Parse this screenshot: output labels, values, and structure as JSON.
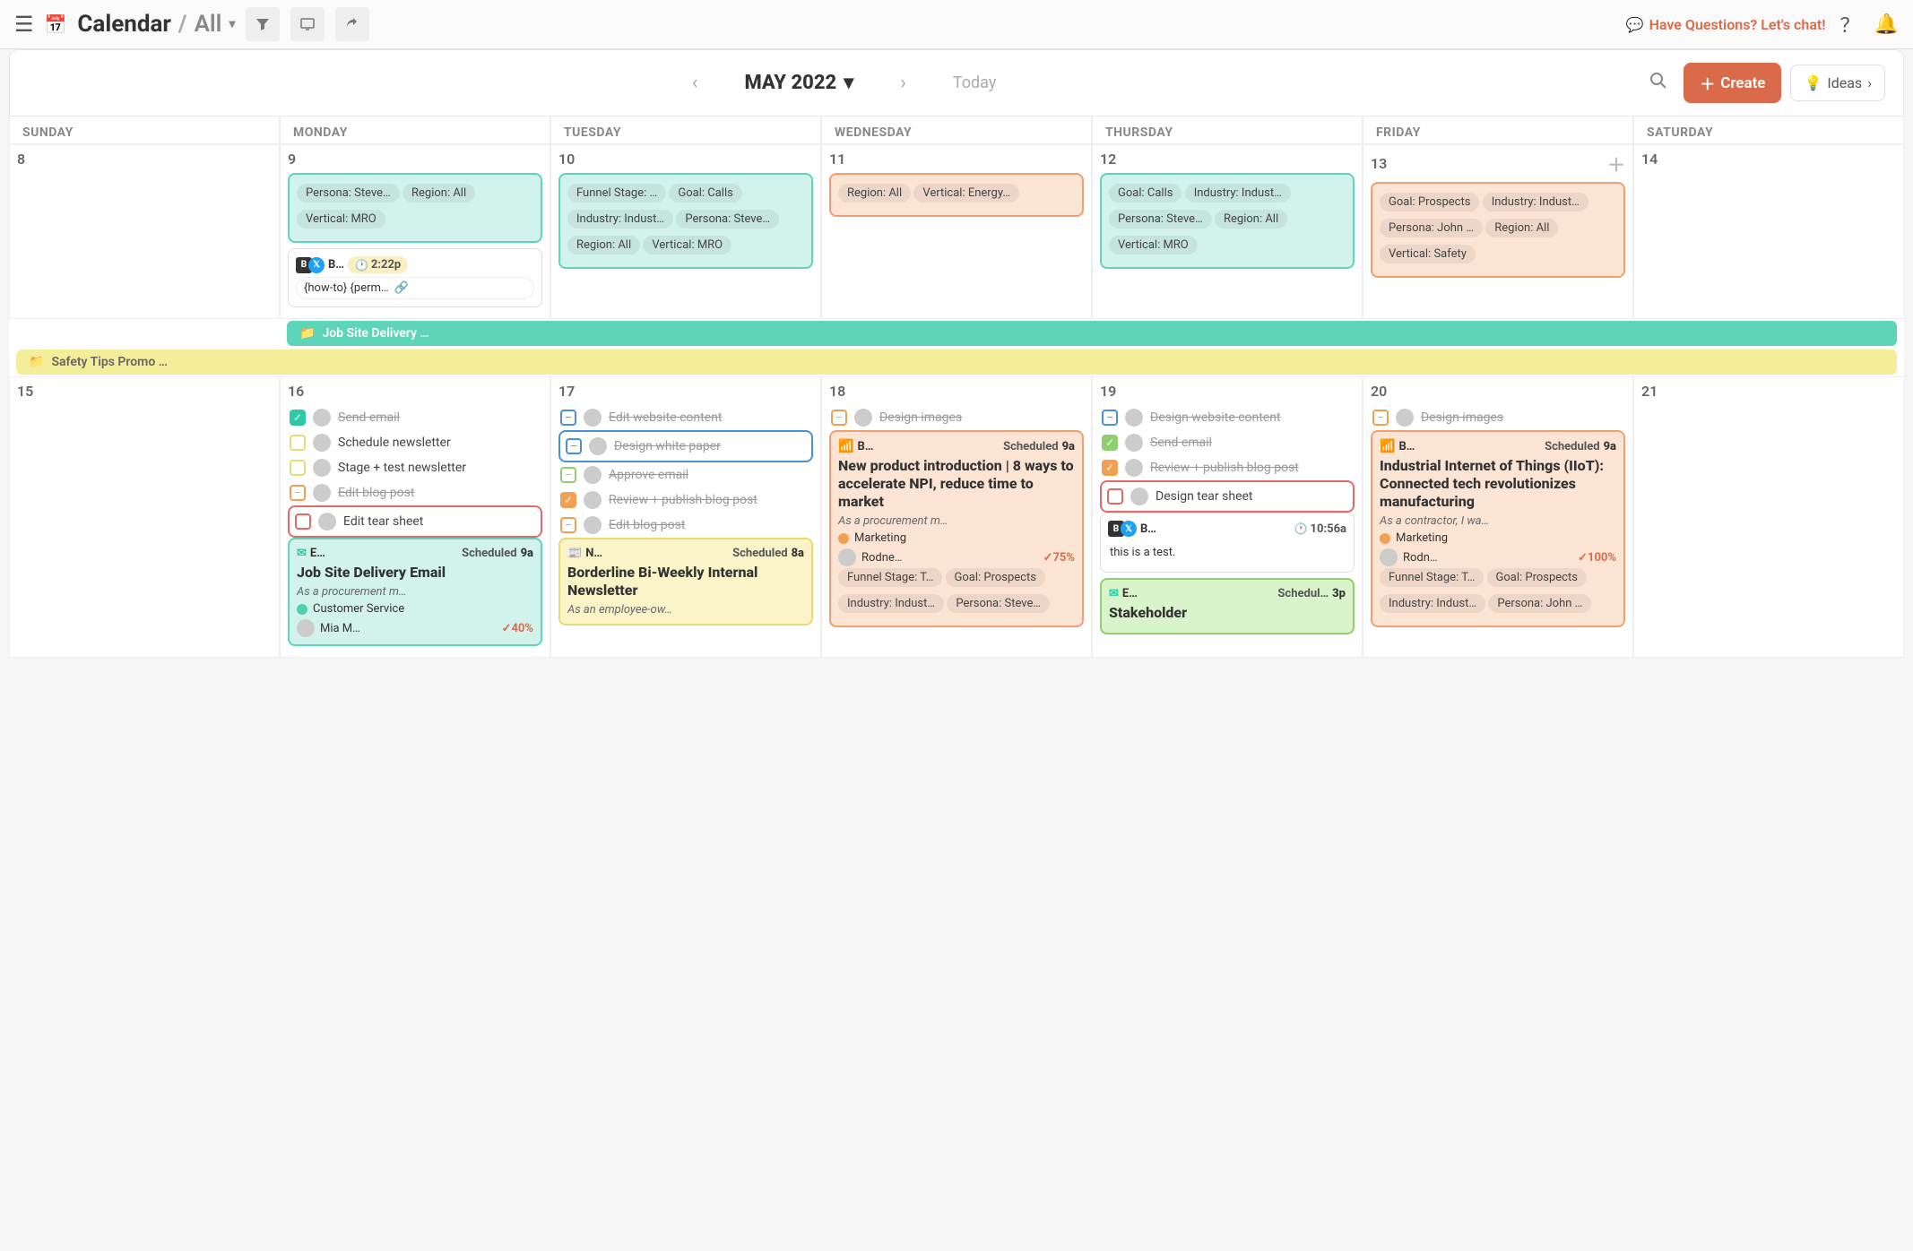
{
  "topbar": {
    "title": "Calendar",
    "filter": "All",
    "chat": "Have Questions? Let's chat!"
  },
  "subbar": {
    "month": "MAY 2022",
    "today": "Today",
    "create": "Create",
    "ideas": "Ideas"
  },
  "days": [
    "SUNDAY",
    "MONDAY",
    "TUESDAY",
    "WEDNESDAY",
    "THURSDAY",
    "FRIDAY",
    "SATURDAY"
  ],
  "week1": {
    "dates": [
      "8",
      "9",
      "10",
      "11",
      "12",
      "13",
      "14"
    ],
    "mon": {
      "tags": [
        "Persona: Steve…",
        "Region: All",
        "Vertical: MRO"
      ],
      "social": {
        "b": "B…",
        "time": "2:22p",
        "body": "{how-to} {perm…"
      }
    },
    "tue": {
      "tags": [
        "Funnel Stage: …",
        "Goal: Calls",
        "Industry: Indust…",
        "Persona: Steve…",
        "Region: All",
        "Vertical: MRO"
      ]
    },
    "wed": {
      "tags": [
        "Region: All",
        "Vertical: Energy…"
      ]
    },
    "thu": {
      "tags": [
        "Goal: Calls",
        "Industry: Indust…",
        "Persona: Steve…",
        "Region: All",
        "Vertical: MRO"
      ]
    },
    "fri": {
      "tags": [
        "Goal: Prospects",
        "Industry: Indust…",
        "Persona: John …",
        "Region: All",
        "Vertical: Safety"
      ]
    }
  },
  "spans": {
    "jobsite": "Job Site Delivery …",
    "safety": "Safety Tips Promo …"
  },
  "week2": {
    "dates": [
      "15",
      "16",
      "17",
      "18",
      "19",
      "20",
      "21"
    ],
    "mon": {
      "tasks": [
        {
          "style": "checked-teal",
          "avatar": true,
          "text": "Send email",
          "strike": true
        },
        {
          "style": "empty-yellow",
          "avatar": true,
          "text": "Schedule newsletter"
        },
        {
          "style": "empty-yellow",
          "avatar": true,
          "text": "Stage + test newsletter"
        },
        {
          "style": "dash-orange",
          "avatar": true,
          "text": "Edit blog post",
          "strike": true,
          "dash": true
        },
        {
          "style": "empty-red",
          "avatar": true,
          "text": "Edit tear sheet",
          "highlight": "red"
        }
      ],
      "card": {
        "type": "E…",
        "sched": "Scheduled",
        "time": "9a",
        "title": "Job Site Delivery Email",
        "subtitle": "As a procurement m…",
        "category": "Customer Service",
        "person": "Mia M…",
        "percent": "40%"
      }
    },
    "tue": {
      "tasks": [
        {
          "style": "dash-blue",
          "avatar": true,
          "text": "Edit website content",
          "strike": true,
          "dash": true
        },
        {
          "style": "dash-blue",
          "avatar": true,
          "text": "Design white paper",
          "strike": true,
          "dash": true,
          "highlight": "blue"
        },
        {
          "style": "dash-green",
          "avatar": true,
          "text": "Approve email",
          "strike": true,
          "dash": true
        },
        {
          "style": "checked-orange",
          "avatar": true,
          "text": "Review + publish blog post",
          "strike": true
        },
        {
          "style": "dash-orange",
          "avatar": true,
          "text": "Edit blog post",
          "strike": true,
          "dash": true
        }
      ],
      "card": {
        "type": "N…",
        "sched": "Scheduled",
        "time": "8a",
        "title": "Borderline Bi-Weekly Internal Newsletter",
        "subtitle": "As an employee-ow…"
      }
    },
    "wed": {
      "tasks": [
        {
          "style": "dash-orange",
          "avatar": true,
          "text": "Design images",
          "strike": true,
          "dash": true
        }
      ],
      "card": {
        "type": "B…",
        "sched": "Scheduled",
        "time": "9a",
        "title": "New product introduction | 8 ways to accelerate NPI, reduce time to market",
        "subtitle": "As a procurement m…",
        "category": "Marketing",
        "person": "Rodne…",
        "percent": "75%",
        "tags": [
          "Funnel Stage: T…",
          "Goal: Prospects",
          "Industry: Indust…",
          "Persona: Steve…"
        ]
      }
    },
    "thu": {
      "tasks": [
        {
          "style": "dash-blue",
          "avatar": true,
          "text": "Design website content",
          "strike": true,
          "dash": true
        },
        {
          "style": "checked-green",
          "avatar": true,
          "text": "Send email",
          "strike": true
        },
        {
          "style": "checked-orange",
          "avatar": true,
          "text": "Review + publish blog post",
          "strike": true
        },
        {
          "style": "empty-red",
          "avatar": true,
          "text": "Design tear sheet",
          "highlight": "red"
        }
      ],
      "social": {
        "b": "B…",
        "time": "10:56a",
        "body": "this is a test."
      },
      "card2": {
        "type": "E…",
        "sched": "Schedul…",
        "time": "3p",
        "title": "Stakeholder"
      }
    },
    "fri": {
      "tasks": [
        {
          "style": "dash-orange",
          "avatar": true,
          "text": "Design images",
          "strike": true,
          "dash": true
        }
      ],
      "card": {
        "type": "B…",
        "sched": "Scheduled",
        "time": "9a",
        "title": "Industrial Internet of Things (IIoT): Connected tech revolutionizes manufacturing",
        "subtitle": "As a contractor, I wa…",
        "category": "Marketing",
        "person": "Rodn…",
        "percent": "100%",
        "tags": [
          "Funnel Stage: T…",
          "Goal: Prospects",
          "Industry: Indust…",
          "Persona: John …"
        ]
      }
    }
  }
}
